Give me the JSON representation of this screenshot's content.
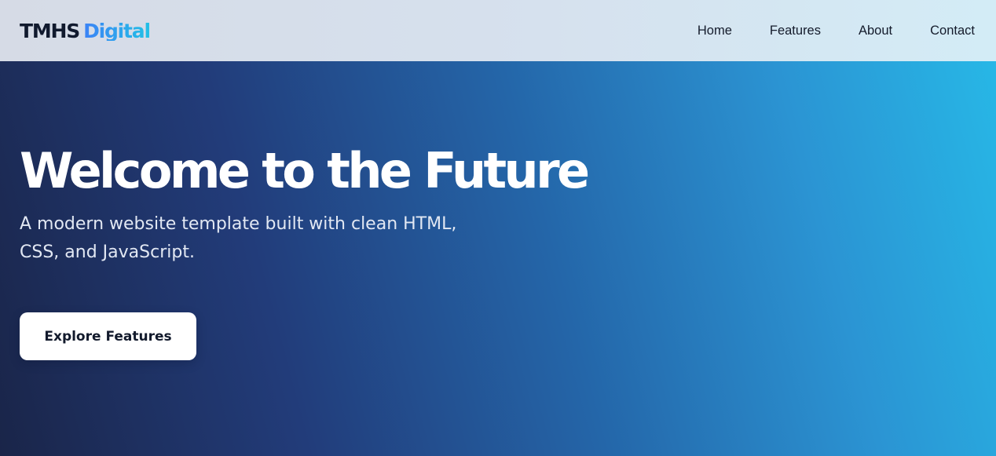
{
  "header": {
    "logo": {
      "brand": "TMHS",
      "accent": "Digital"
    },
    "nav": [
      {
        "label": "Home"
      },
      {
        "label": "Features"
      },
      {
        "label": "About"
      },
      {
        "label": "Contact"
      }
    ]
  },
  "hero": {
    "title": "Welcome to the Future",
    "subtitle": "A modern website template built with clean HTML, CSS, and JavaScript.",
    "cta_label": "Explore Features"
  },
  "colors": {
    "text_dark": "#111a2e",
    "logo_gradient": [
      "#3b82f6",
      "#22c0e6"
    ],
    "hero_gradient": [
      "#1a2549",
      "#223c7a",
      "#2466a9",
      "#2b94d3",
      "#27b7e6"
    ],
    "button_bg": "#ffffff"
  }
}
